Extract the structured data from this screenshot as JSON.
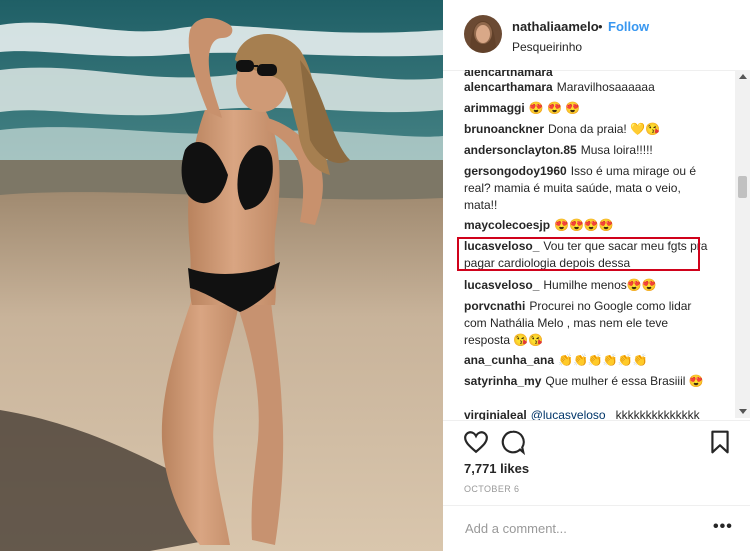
{
  "header": {
    "username": "nathaliaamelo",
    "separator": "•",
    "follow_label": "Follow",
    "location": "Pesqueirinho"
  },
  "comments": [
    {
      "user": "alencarthamara",
      "text": "Maravilhosaaaaaa"
    },
    {
      "user": "arimmaggi",
      "text": "😍 😍 😍"
    },
    {
      "user": "brunoanckner",
      "text": "Dona da praia! 💛😘"
    },
    {
      "user": "andersonclayton.85",
      "text": "Musa loira!!!!!"
    },
    {
      "user": "gersongodoy1960",
      "text": "Isso é uma mirage ou é real? mamia é muita saúde, mata o veio, mata!!"
    },
    {
      "user": "maycolecoesjp",
      "text": "😍😍😍😍"
    },
    {
      "user": "lucasveloso_",
      "text": "Vou ter que sacar meu fgts pra pagar cardiologia depois dessa"
    },
    {
      "user": "lucasveloso_",
      "text": "Humilhe menos😍😍"
    },
    {
      "user": "porvcnathi",
      "text": "Procurei no Google como lidar com Nathália Melo , mas nem ele teve resposta 😘😘"
    },
    {
      "user": "ana_cunha_ana",
      "text": "👏👏👏👏👏👏"
    },
    {
      "user": "satyrinha_my",
      "text": "Que mulher é essa Brasiiil 😍"
    },
    {
      "user": "virginialeal",
      "mention": "@lucasveloso_",
      "text": "kkkkkkkkkkkkkk"
    }
  ],
  "actions": {
    "like_icon": "heart-icon",
    "comment_icon": "comment-bubble-icon",
    "save_icon": "bookmark-icon"
  },
  "likes": "7,771 likes",
  "date": "OCTOBER 6",
  "comment_box": {
    "placeholder": "Add a comment...",
    "more_label": "•••"
  },
  "colors": {
    "link": "#3897f0",
    "highlight": "#d0021b",
    "text": "#262626",
    "muted": "#999999"
  }
}
